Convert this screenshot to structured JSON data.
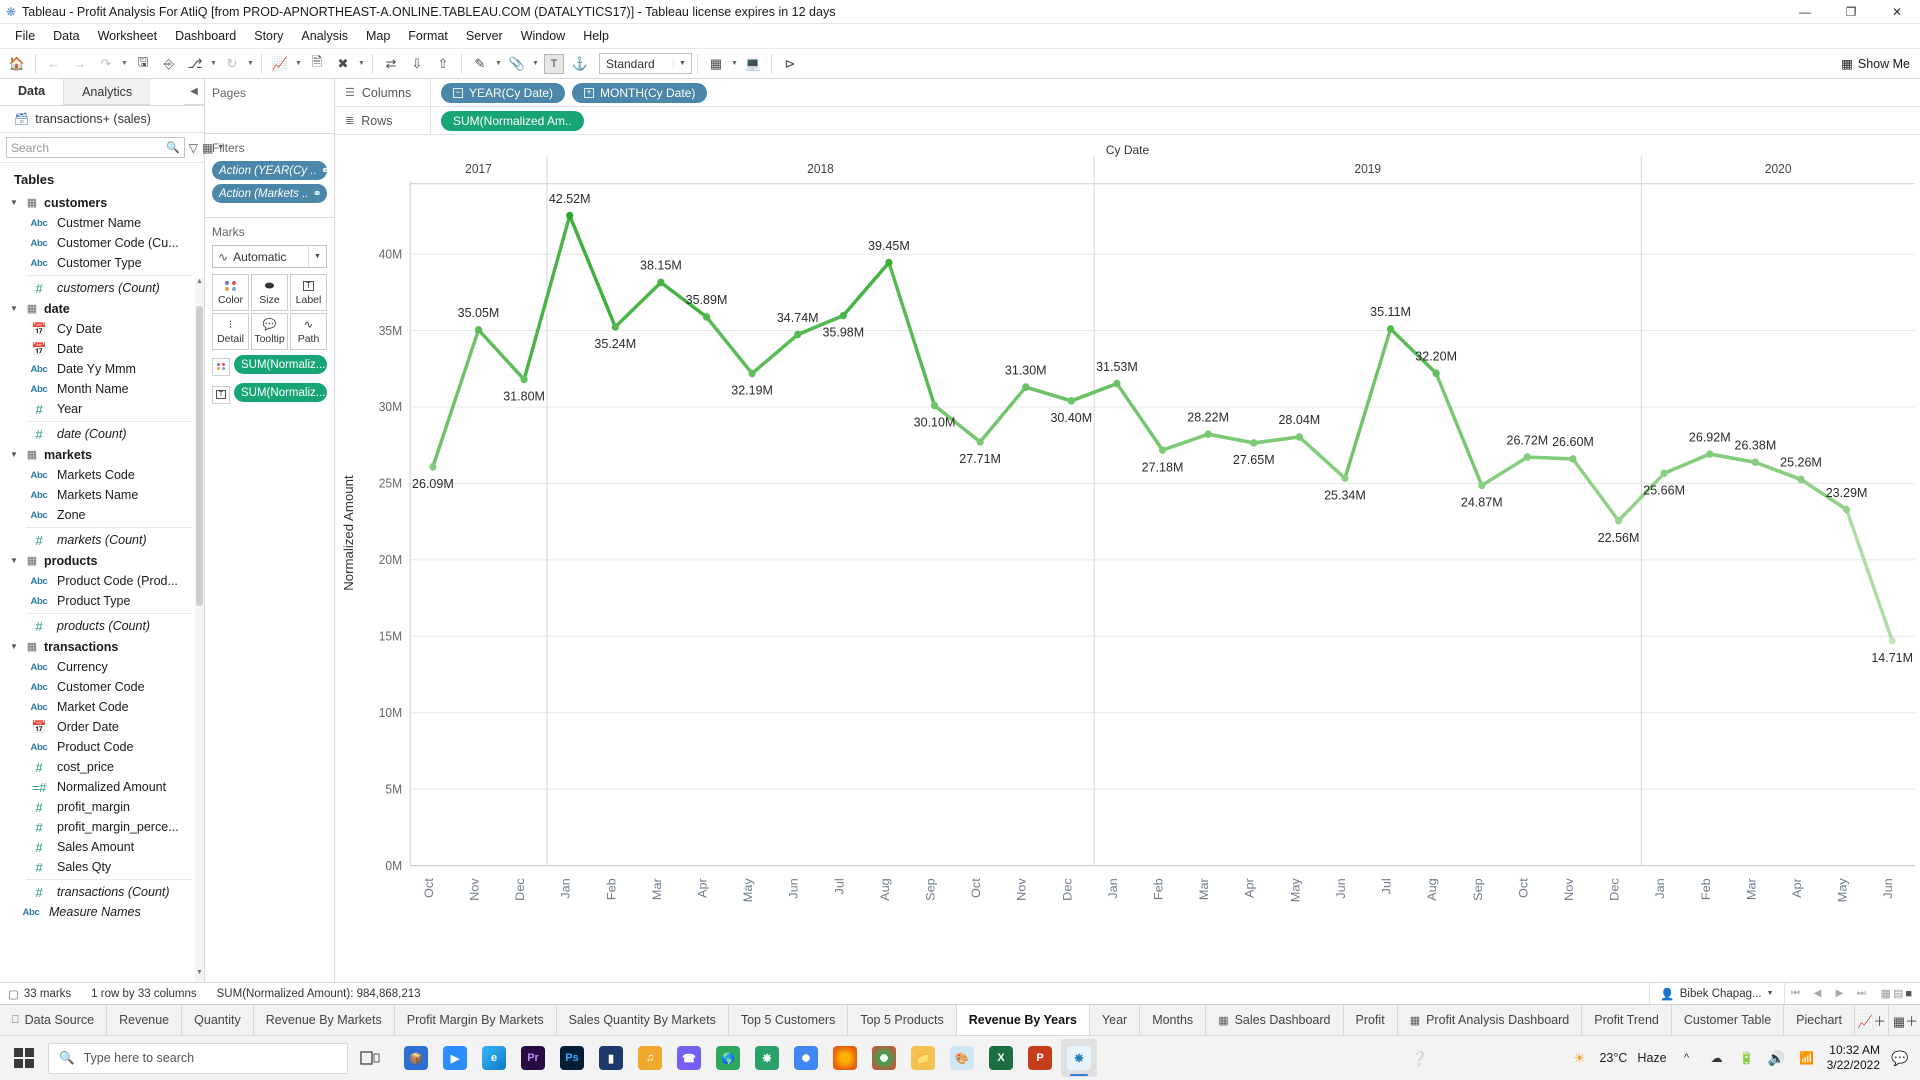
{
  "window": {
    "title": "Tableau - Profit Analysis For AtliQ [from PROD-APNORTHEAST-A.ONLINE.TABLEAU.COM (DATALYTICS17)] - Tableau license expires in 12 days",
    "minimize": "—",
    "maximize": "❐",
    "close": "✕"
  },
  "menu": [
    "File",
    "Data",
    "Worksheet",
    "Dashboard",
    "Story",
    "Analysis",
    "Map",
    "Format",
    "Server",
    "Window",
    "Help"
  ],
  "toolbar": {
    "fit_value": "Standard",
    "show_me": "Show Me"
  },
  "data_pane": {
    "tab_data": "Data",
    "tab_analytics": "Analytics",
    "datasource": "transactions+ (sales)",
    "search_placeholder": "Search",
    "tables_heading": "Tables",
    "tables": [
      {
        "name": "customers",
        "fields": [
          {
            "label": "Custmer Name",
            "type": "Abc"
          },
          {
            "label": "Customer Code (Cu...",
            "type": "Abc"
          },
          {
            "label": "Customer Type",
            "type": "Abc"
          },
          {
            "label": "customers (Count)",
            "type": "#",
            "italic": true
          }
        ]
      },
      {
        "name": "date",
        "fields": [
          {
            "label": "Cy Date",
            "type": "date"
          },
          {
            "label": "Date",
            "type": "date"
          },
          {
            "label": "Date Yy Mmm",
            "type": "Abc"
          },
          {
            "label": "Month Name",
            "type": "Abc"
          },
          {
            "label": "Year",
            "type": "#"
          },
          {
            "label": "date (Count)",
            "type": "#",
            "italic": true
          }
        ]
      },
      {
        "name": "markets",
        "fields": [
          {
            "label": "Markets Code",
            "type": "Abc"
          },
          {
            "label": "Markets Name",
            "type": "Abc"
          },
          {
            "label": "Zone",
            "type": "Abc"
          },
          {
            "label": "markets (Count)",
            "type": "#",
            "italic": true
          }
        ]
      },
      {
        "name": "products",
        "fields": [
          {
            "label": "Product Code (Prod...",
            "type": "Abc"
          },
          {
            "label": "Product Type",
            "type": "Abc"
          },
          {
            "label": "products (Count)",
            "type": "#",
            "italic": true
          }
        ]
      },
      {
        "name": "transactions",
        "fields": [
          {
            "label": "Currency",
            "type": "Abc"
          },
          {
            "label": "Customer Code",
            "type": "Abc"
          },
          {
            "label": "Market Code",
            "type": "Abc"
          },
          {
            "label": "Order Date",
            "type": "date"
          },
          {
            "label": "Product Code",
            "type": "Abc"
          },
          {
            "label": "cost_price",
            "type": "#"
          },
          {
            "label": "Normalized Amount",
            "type": "=#"
          },
          {
            "label": "profit_margin",
            "type": "#"
          },
          {
            "label": "profit_margin_perce...",
            "type": "#"
          },
          {
            "label": "Sales Amount",
            "type": "#"
          },
          {
            "label": "Sales Qty",
            "type": "#"
          },
          {
            "label": "transactions (Count)",
            "type": "#",
            "italic": true
          }
        ]
      }
    ],
    "measure_names": "Measure Names"
  },
  "shelves": {
    "pages_label": "Pages",
    "filters_label": "Filters",
    "filters": [
      "Action (YEAR(Cy ..",
      "Action (Markets .."
    ],
    "marks_label": "Marks",
    "marks_type": "Automatic",
    "mark_cards": [
      {
        "label": "Color",
        "icon": "color-dots"
      },
      {
        "label": "Size",
        "icon": "size"
      },
      {
        "label": "Label",
        "icon": "label-T"
      },
      {
        "label": "Detail",
        "icon": "detail-dots"
      },
      {
        "label": "Tooltip",
        "icon": "tooltip"
      },
      {
        "label": "Path",
        "icon": "path-line"
      }
    ],
    "mark_pills": [
      {
        "label": "SUM(Normaliz...",
        "chip": "color"
      },
      {
        "label": "SUM(Normaliz...",
        "chip": "T"
      }
    ],
    "columns_label": "Columns",
    "rows_label": "Rows",
    "columns_pills": [
      "YEAR(Cy Date)",
      "MONTH(Cy Date)"
    ],
    "rows_pills": [
      "SUM(Normalized Am.."
    ]
  },
  "chart_data": {
    "type": "line",
    "title": "Cy Date",
    "xlabel": "",
    "ylabel": "Normalized Amount",
    "ylim": [
      0,
      43.5
    ],
    "ytick_labels": [
      "0M",
      "5M",
      "10M",
      "15M",
      "20M",
      "25M",
      "30M",
      "35M",
      "40M"
    ],
    "ytick_values": [
      0,
      5,
      10,
      15,
      20,
      25,
      30,
      35,
      40
    ],
    "grid": true,
    "legend": "none",
    "line_color": "#4fc24f",
    "years": [
      {
        "year": "2017",
        "months": [
          "Oct",
          "Nov",
          "Dec"
        ]
      },
      {
        "year": "2018",
        "months": [
          "Jan",
          "Feb",
          "Mar",
          "Apr",
          "May",
          "Jun",
          "Jul",
          "Aug",
          "Sep",
          "Oct",
          "Nov",
          "Dec"
        ]
      },
      {
        "year": "2019",
        "months": [
          "Jan",
          "Feb",
          "Mar",
          "Apr",
          "May",
          "Jun",
          "Jul",
          "Aug",
          "Sep",
          "Oct",
          "Nov",
          "Dec"
        ]
      },
      {
        "year": "2020",
        "months": [
          "Jan",
          "Feb",
          "Mar",
          "Apr",
          "May",
          "Jun"
        ]
      }
    ],
    "points": [
      {
        "x": "2017-Oct",
        "value": 26.09,
        "label": "26.09M",
        "label_pos": "below"
      },
      {
        "x": "2017-Nov",
        "value": 35.05,
        "label": "35.05M",
        "label_pos": "above"
      },
      {
        "x": "2017-Dec",
        "value": 31.8,
        "label": "31.80M",
        "label_pos": "below"
      },
      {
        "x": "2018-Jan",
        "value": 42.52,
        "label": "42.52M",
        "label_pos": "above"
      },
      {
        "x": "2018-Feb",
        "value": 35.24,
        "label": "35.24M",
        "label_pos": "below"
      },
      {
        "x": "2018-Mar",
        "value": 38.15,
        "label": "38.15M",
        "label_pos": "above"
      },
      {
        "x": "2018-Apr",
        "value": 35.89,
        "label": "35.89M",
        "label_pos": "above"
      },
      {
        "x": "2018-May",
        "value": 32.19,
        "label": "32.19M",
        "label_pos": "below"
      },
      {
        "x": "2018-Jun",
        "value": 34.74,
        "label": "34.74M",
        "label_pos": "above"
      },
      {
        "x": "2018-Jul",
        "value": 35.98,
        "label": "35.98M",
        "label_pos": "below"
      },
      {
        "x": "2018-Aug",
        "value": 39.45,
        "label": "39.45M",
        "label_pos": "above"
      },
      {
        "x": "2018-Sep",
        "value": 30.1,
        "label": "30.10M",
        "label_pos": "below"
      },
      {
        "x": "2018-Oct",
        "value": 27.71,
        "label": "27.71M",
        "label_pos": "below"
      },
      {
        "x": "2018-Nov",
        "value": 31.3,
        "label": "31.30M",
        "label_pos": "above"
      },
      {
        "x": "2018-Dec",
        "value": 30.4,
        "label": "30.40M",
        "label_pos": "below"
      },
      {
        "x": "2019-Jan",
        "value": 31.53,
        "label": "31.53M",
        "label_pos": "above"
      },
      {
        "x": "2019-Feb",
        "value": 27.18,
        "label": "27.18M",
        "label_pos": "below"
      },
      {
        "x": "2019-Mar",
        "value": 28.22,
        "label": "28.22M",
        "label_pos": "above"
      },
      {
        "x": "2019-Apr",
        "value": 27.65,
        "label": "27.65M",
        "label_pos": "below"
      },
      {
        "x": "2019-May",
        "value": 28.04,
        "label": "28.04M",
        "label_pos": "above"
      },
      {
        "x": "2019-Jun",
        "value": 25.34,
        "label": "25.34M",
        "label_pos": "below"
      },
      {
        "x": "2019-Jul",
        "value": 35.11,
        "label": "35.11M",
        "label_pos": "above"
      },
      {
        "x": "2019-Aug",
        "value": 32.2,
        "label": "32.20M",
        "label_pos": "above"
      },
      {
        "x": "2019-Sep",
        "value": 24.87,
        "label": "24.87M",
        "label_pos": "below"
      },
      {
        "x": "2019-Oct",
        "value": 26.72,
        "label": "26.72M",
        "label_pos": "above"
      },
      {
        "x": "2019-Nov",
        "value": 26.6,
        "label": "26.60M",
        "label_pos": "above"
      },
      {
        "x": "2019-Dec",
        "value": 22.56,
        "label": "22.56M",
        "label_pos": "below"
      },
      {
        "x": "2020-Jan",
        "value": 25.66,
        "label": "25.66M",
        "label_pos": "below"
      },
      {
        "x": "2020-Feb",
        "value": 26.92,
        "label": "26.92M",
        "label_pos": "above"
      },
      {
        "x": "2020-Mar",
        "value": 26.38,
        "label": "26.38M",
        "label_pos": "above"
      },
      {
        "x": "2020-Apr",
        "value": 25.26,
        "label": "25.26M",
        "label_pos": "above"
      },
      {
        "x": "2020-May",
        "value": 23.29,
        "label": "23.29M",
        "label_pos": "above"
      },
      {
        "x": "2020-Jun",
        "value": 14.71,
        "label": "14.71M",
        "label_pos": "below"
      }
    ]
  },
  "status": {
    "marks": "33 marks",
    "dims": "1 row by 33 columns",
    "sum": "SUM(Normalized Amount): 984,868,213",
    "user": "Bibek Chapag..."
  },
  "worksheet_tabs": [
    {
      "label": "Data Source",
      "icon": "datasource",
      "active": false
    },
    {
      "label": "Revenue",
      "icon": "",
      "active": false
    },
    {
      "label": "Quantity",
      "icon": "",
      "active": false
    },
    {
      "label": "Revenue By Markets",
      "icon": "",
      "active": false
    },
    {
      "label": "Profit Margin By Markets",
      "icon": "",
      "active": false
    },
    {
      "label": "Sales Quantity By Markets",
      "icon": "",
      "active": false
    },
    {
      "label": "Top 5 Customers",
      "icon": "",
      "active": false
    },
    {
      "label": "Top 5 Products",
      "icon": "",
      "active": false
    },
    {
      "label": "Revenue By Years",
      "icon": "",
      "active": true
    },
    {
      "label": "Year",
      "icon": "",
      "active": false
    },
    {
      "label": "Months",
      "icon": "",
      "active": false
    },
    {
      "label": "Sales Dashboard",
      "icon": "dashboard",
      "active": false
    },
    {
      "label": "Profit",
      "icon": "",
      "active": false
    },
    {
      "label": "Profit Analysis Dashboard",
      "icon": "dashboard",
      "active": false
    },
    {
      "label": "Profit Trend",
      "icon": "",
      "active": false
    },
    {
      "label": "Customer Table",
      "icon": "",
      "active": false
    },
    {
      "label": "Piechart",
      "icon": "",
      "active": false
    }
  ],
  "new_tab_buttons": [
    "new-worksheet",
    "new-dashboard",
    "new-story"
  ],
  "taskbar": {
    "search_placeholder": "Type here to search",
    "temperature": "23°C",
    "weather": "Haze",
    "time": "10:32 AM",
    "date": "3/22/2022"
  }
}
